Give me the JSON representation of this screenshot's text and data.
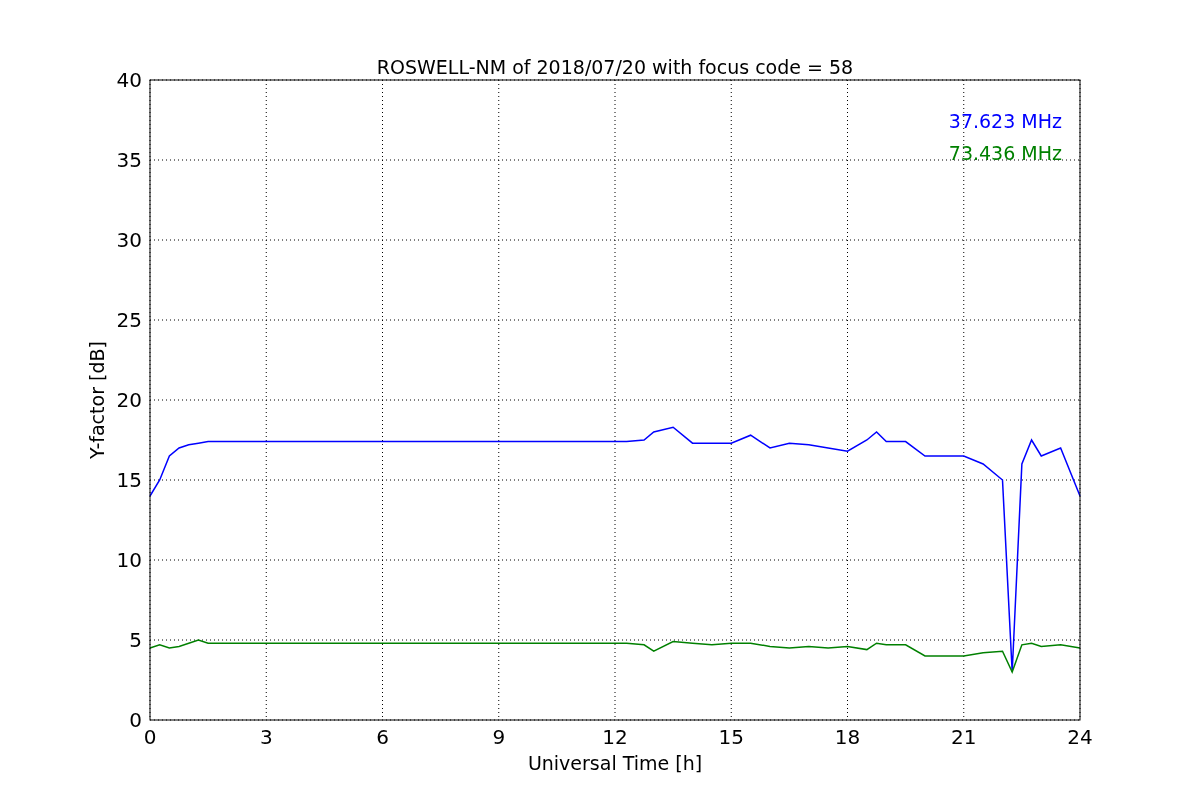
{
  "chart_data": {
    "type": "line",
    "title": "ROSWELL-NM of 2018/07/20 with focus code = 58",
    "xlabel": "Universal Time [h]",
    "ylabel": "Y-factor [dB]",
    "x": [
      0,
      0.25,
      0.5,
      0.75,
      1,
      1.25,
      1.5,
      12.3,
      12.75,
      13,
      13.5,
      14,
      14.5,
      15,
      15.5,
      16,
      16.5,
      17,
      17.5,
      18,
      18.5,
      18.75,
      19,
      19.5,
      20,
      20.5,
      21,
      21.5,
      22,
      22.25,
      22.5,
      22.75,
      23,
      23.5,
      24
    ],
    "series": [
      {
        "name": "37.623 MHz",
        "color": "#0000ff",
        "values": [
          14,
          15,
          16.5,
          17,
          17.2,
          17.3,
          17.4,
          17.4,
          17.5,
          18,
          18.3,
          17.3,
          17.3,
          17.3,
          17.8,
          17,
          17.3,
          17.2,
          17,
          16.8,
          17.5,
          18,
          17.4,
          17.4,
          16.5,
          16.5,
          16.5,
          16,
          15,
          3,
          16,
          17.5,
          16.5,
          17,
          14
        ]
      },
      {
        "name": "73.436 MHz",
        "color": "#008000",
        "values": [
          4.5,
          4.7,
          4.5,
          4.6,
          4.8,
          5,
          4.8,
          4.8,
          4.7,
          4.3,
          4.9,
          4.8,
          4.7,
          4.8,
          4.8,
          4.6,
          4.5,
          4.6,
          4.5,
          4.6,
          4.4,
          4.8,
          4.7,
          4.7,
          4,
          4,
          4,
          4.2,
          4.3,
          3,
          4.7,
          4.8,
          4.6,
          4.7,
          4.5
        ]
      }
    ],
    "grid": true,
    "xlim": [
      0,
      24
    ],
    "ylim": [
      0,
      40
    ],
    "xticks": [
      0,
      3,
      6,
      9,
      12,
      15,
      18,
      21,
      24
    ],
    "yticks": [
      0,
      5,
      10,
      15,
      20,
      25,
      30,
      35,
      40
    ]
  }
}
